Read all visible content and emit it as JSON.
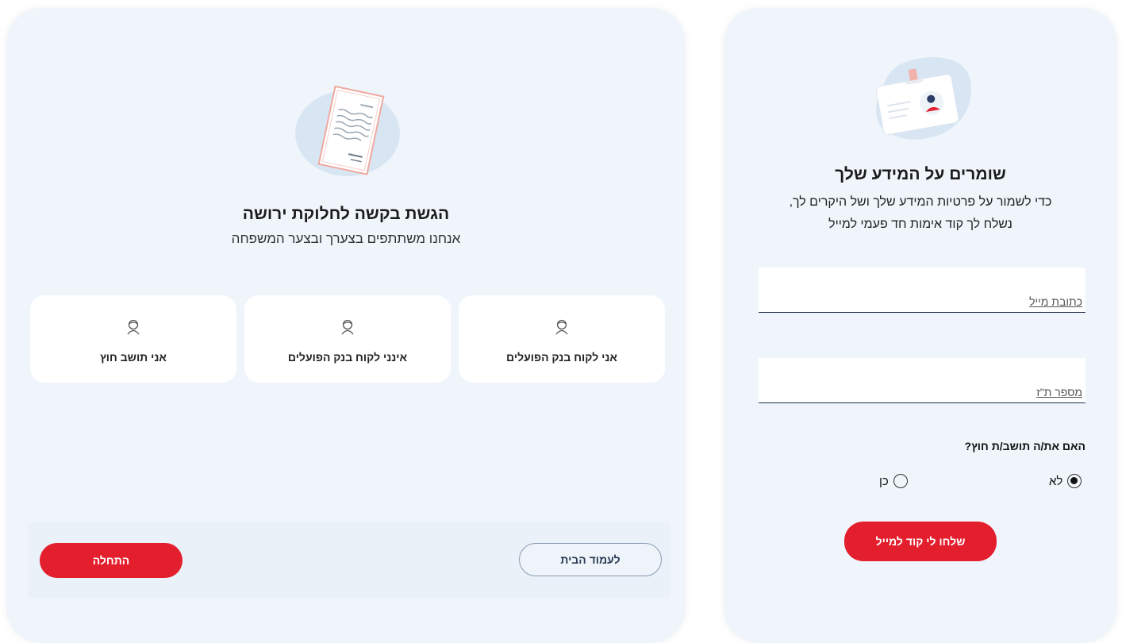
{
  "inheritance": {
    "title": "הגשת בקשה לחלוקת ירושה",
    "subtitle": "אנחנו משתתפים בצערך ובצער המשפחה",
    "options": [
      {
        "label": "אני לקוח בנק הפועלים",
        "icon": "person-icon"
      },
      {
        "label": "אינני לקוח בנק הפועלים",
        "icon": "person-icon"
      },
      {
        "label": "אני תושב חוץ",
        "icon": "person-icon"
      }
    ],
    "home_button": "לעמוד הבית",
    "start_button": "התחלה"
  },
  "verification": {
    "title": "שומרים על המידע שלך",
    "desc_line1": "כדי לשמור על פרטיות המידע שלך ושל היקרים לך,",
    "desc_line2": "נשלח לך קוד אימות חד פעמי למייל",
    "email_placeholder": "כתובת מייל",
    "id_placeholder": "מספר ת\"ז",
    "question": "האם את/ה תושב/ת חוץ?",
    "radio_no": "לא",
    "radio_yes": "כן",
    "selected": "no",
    "submit_button": "שלחו לי קוד למייל"
  },
  "colors": {
    "accent_red": "#e31e2d",
    "panel_bg": "#eff5fb"
  }
}
